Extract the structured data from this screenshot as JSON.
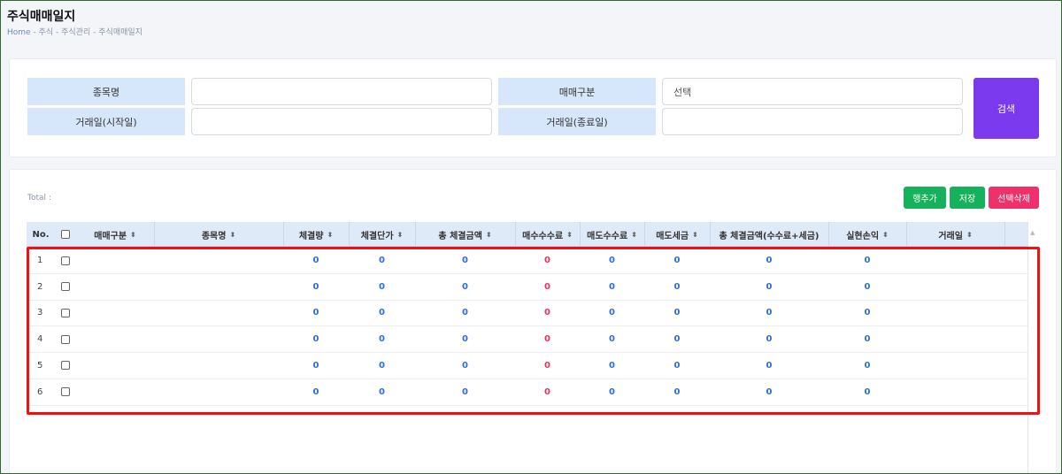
{
  "page": {
    "title": "주식매매일지",
    "breadcrumb": [
      "Home",
      "주식",
      "주식관리",
      "주식매매일지"
    ],
    "breadcrumb_sep": "-"
  },
  "search": {
    "stock_name_label": "종목명",
    "trade_type_label": "매매구분",
    "trade_type_value": "선택",
    "start_date_label": "거래일(시작일)",
    "end_date_label": "거래일(종료일)",
    "search_button": "검색"
  },
  "list": {
    "total_label": "Total :",
    "add_row_button": "행추가",
    "save_button": "저장",
    "delete_selected_button": "선택삭제",
    "columns": {
      "no": "No.",
      "trade_type": "매매구분",
      "stock_name": "종목명",
      "quantity": "체결량",
      "unit_price": "체결단가",
      "total_amount": "총 체결금액",
      "buy_fee": "매수수수료",
      "sell_fee": "매도수수료",
      "sell_tax": "매도세금",
      "total_amount_fee_tax": "총 체결금액(수수료+세금)",
      "realized_pl": "실현손익",
      "trade_date": "거래일"
    },
    "sort_icon": "⬍",
    "rows": [
      {
        "no": "1",
        "quantity": "0",
        "unit_price": "0",
        "total_amount": "0",
        "buy_fee": "0",
        "sell_fee": "0",
        "sell_tax": "0",
        "total_amount_fee_tax": "0",
        "realized_pl": "0"
      },
      {
        "no": "2",
        "quantity": "0",
        "unit_price": "0",
        "total_amount": "0",
        "buy_fee": "0",
        "sell_fee": "0",
        "sell_tax": "0",
        "total_amount_fee_tax": "0",
        "realized_pl": "0"
      },
      {
        "no": "3",
        "quantity": "0",
        "unit_price": "0",
        "total_amount": "0",
        "buy_fee": "0",
        "sell_fee": "0",
        "sell_tax": "0",
        "total_amount_fee_tax": "0",
        "realized_pl": "0"
      },
      {
        "no": "4",
        "quantity": "0",
        "unit_price": "0",
        "total_amount": "0",
        "buy_fee": "0",
        "sell_fee": "0",
        "sell_tax": "0",
        "total_amount_fee_tax": "0",
        "realized_pl": "0"
      },
      {
        "no": "5",
        "quantity": "0",
        "unit_price": "0",
        "total_amount": "0",
        "buy_fee": "0",
        "sell_fee": "0",
        "sell_tax": "0",
        "total_amount_fee_tax": "0",
        "realized_pl": "0"
      },
      {
        "no": "6",
        "quantity": "0",
        "unit_price": "0",
        "total_amount": "0",
        "buy_fee": "0",
        "sell_fee": "0",
        "sell_tax": "0",
        "total_amount_fee_tax": "0",
        "realized_pl": "0"
      }
    ]
  },
  "colors": {
    "accent_purple": "#7b3aed",
    "green": "#16b25b",
    "pink": "#f0306a",
    "value_blue": "#2e6fd8",
    "value_red": "#e8335f",
    "highlight_red": "#ee1111"
  }
}
